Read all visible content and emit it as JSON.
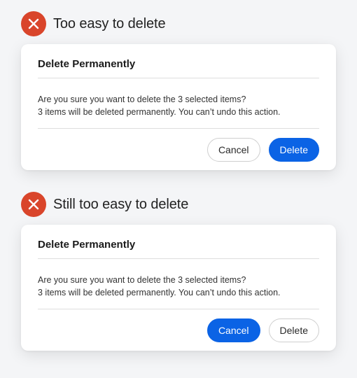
{
  "examples": [
    {
      "heading": "Too easy to delete",
      "dialog": {
        "title": "Delete Permanently",
        "body_line1": "Are you sure you want to delete the 3 selected items?",
        "body_line2": "3 items will be deleted permanently. You can’t undo this action.",
        "left_button": "Cancel",
        "right_button": "Delete"
      }
    },
    {
      "heading": "Still too easy to delete",
      "dialog": {
        "title": "Delete Permanently",
        "body_line1": "Are you sure you want to delete the 3 selected items?",
        "body_line2": "3 items will be deleted permanently. You can’t undo this action.",
        "left_button": "Cancel",
        "right_button": "Delete"
      }
    }
  ],
  "colors": {
    "error_badge": "#d9452b",
    "primary_button": "#0b63e5"
  },
  "icons": {
    "status": "x-mark-icon"
  }
}
